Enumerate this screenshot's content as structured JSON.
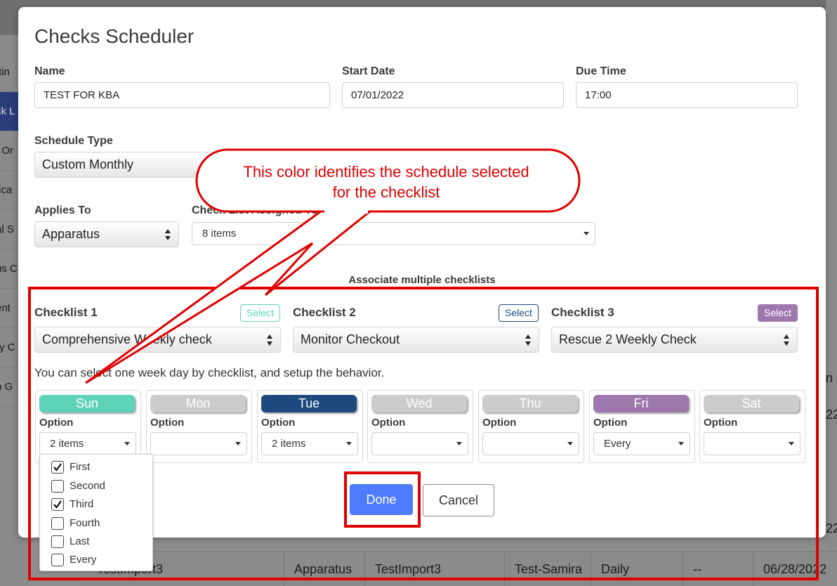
{
  "background": {
    "sidebar": [
      "ttin",
      "ck L",
      "t Or",
      "fica",
      "al S",
      "us C",
      "ent",
      "ry C",
      "n G"
    ],
    "table_row": [
      "TestImport3",
      "Apparatus",
      "TestImport3",
      "Test-Samira",
      "Daily",
      "--",
      "06/28/2022"
    ],
    "right_edge": [
      "n",
      "22",
      "22"
    ]
  },
  "modal": {
    "title": "Checks Scheduler",
    "name": {
      "label": "Name",
      "value": "TEST FOR KBA"
    },
    "start_date": {
      "label": "Start Date",
      "value": "07/01/2022"
    },
    "due_time": {
      "label": "Due Time",
      "value": "17:00"
    },
    "schedule_type": {
      "label": "Schedule Type",
      "value": "Custom Monthly"
    },
    "applies_to": {
      "label": "Applies To",
      "value": "Apparatus"
    },
    "checklist_assigned": {
      "label": "Check List Assigned To",
      "value": "8 items"
    },
    "associate_title": "Associate multiple checklists",
    "checklists": [
      {
        "label": "Checklist 1",
        "select_label": "Select",
        "value": "Comprehensive Weekly check",
        "color": "#5fd3b8"
      },
      {
        "label": "Checklist 2",
        "select_label": "Select",
        "value": "Monitor Checkout",
        "color": "#1d4a7e"
      },
      {
        "label": "Checklist 3",
        "select_label": "Select",
        "value": "Rescue 2 Weekly Check",
        "color": "#9e77ad"
      }
    ],
    "hint": "You can select one week day by checklist, and setup the behavior.",
    "option_label": "Option",
    "days": [
      {
        "name": "Sun",
        "color": "#5fd3b8",
        "option": "2 items"
      },
      {
        "name": "Mon",
        "color": "#cccccc",
        "option": ""
      },
      {
        "name": "Tue",
        "color": "#1d4a7e",
        "option": "2 items"
      },
      {
        "name": "Wed",
        "color": "#cccccc",
        "option": ""
      },
      {
        "name": "Thu",
        "color": "#cccccc",
        "option": ""
      },
      {
        "name": "Fri",
        "color": "#9e77ad",
        "option": "Every"
      },
      {
        "name": "Sat",
        "color": "#cccccc",
        "option": ""
      }
    ],
    "done_label": "Done",
    "cancel_label": "Cancel"
  },
  "popover": {
    "items": [
      {
        "label": "First",
        "checked": true
      },
      {
        "label": "Second",
        "checked": false
      },
      {
        "label": "Third",
        "checked": true
      },
      {
        "label": "Fourth",
        "checked": false
      },
      {
        "label": "Last",
        "checked": false
      },
      {
        "label": "Every",
        "checked": false
      }
    ]
  },
  "annotation": {
    "callout_line1": "This color identifies the schedule selected",
    "callout_line2": "for the checklist",
    "color": "#e00000"
  }
}
